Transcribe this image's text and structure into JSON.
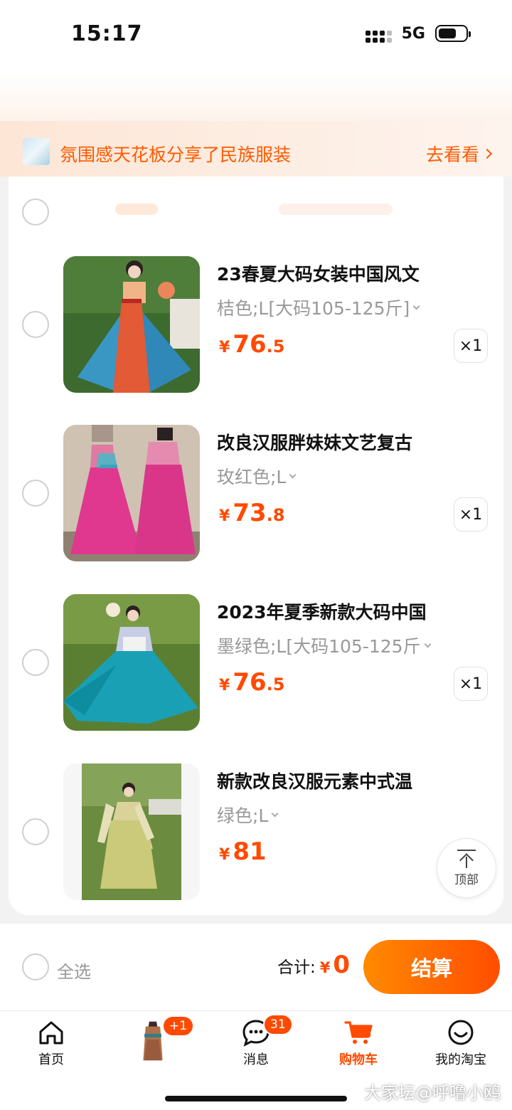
{
  "status_bar": {
    "time": "15:17",
    "network": "5G"
  },
  "share_banner": {
    "text": "氛围感天花板分享了民族服装",
    "link": "去看看"
  },
  "items": [
    {
      "title": "23春夏大码女装中国风文",
      "sku": "桔色;L[大码105-125斤]",
      "currency": "¥",
      "price_int": "76",
      "price_dec": ".5",
      "qty": "×1"
    },
    {
      "title": "改良汉服胖妹妹文艺复古",
      "sku": "玫红色;L",
      "currency": "¥",
      "price_int": "73",
      "price_dec": ".8",
      "qty": "×1"
    },
    {
      "title": "2023年夏季新款大码中国",
      "sku": "墨绿色;L[大码105-125斤",
      "currency": "¥",
      "price_int": "76",
      "price_dec": ".5",
      "qty": "×1"
    },
    {
      "title": "新款改良汉服元素中式温",
      "sku": "绿色;L",
      "currency": "¥",
      "price_int": "81",
      "price_dec": "",
      "qty": ""
    }
  ],
  "to_top": {
    "label": "顶部"
  },
  "checkout": {
    "select_all": "全选",
    "total_label": "合计:",
    "currency": "¥",
    "total_value": "0",
    "button": "结算"
  },
  "tabs": [
    {
      "label": "首页",
      "icon": "home-icon"
    },
    {
      "label": "",
      "icon": "product-thumbnail",
      "badge": "+1"
    },
    {
      "label": "消息",
      "icon": "message-icon",
      "badge": "31"
    },
    {
      "label": "购物车",
      "icon": "cart-icon",
      "active": true
    },
    {
      "label": "我的淘宝",
      "icon": "profile-icon"
    }
  ],
  "watermark": "大家坛@呼噜小鸥",
  "colors": {
    "accent": "#ff4a00",
    "checkout_gradient": [
      "#ff8a00",
      "#ff4d00"
    ],
    "banner_bg": "#fde6d6"
  }
}
